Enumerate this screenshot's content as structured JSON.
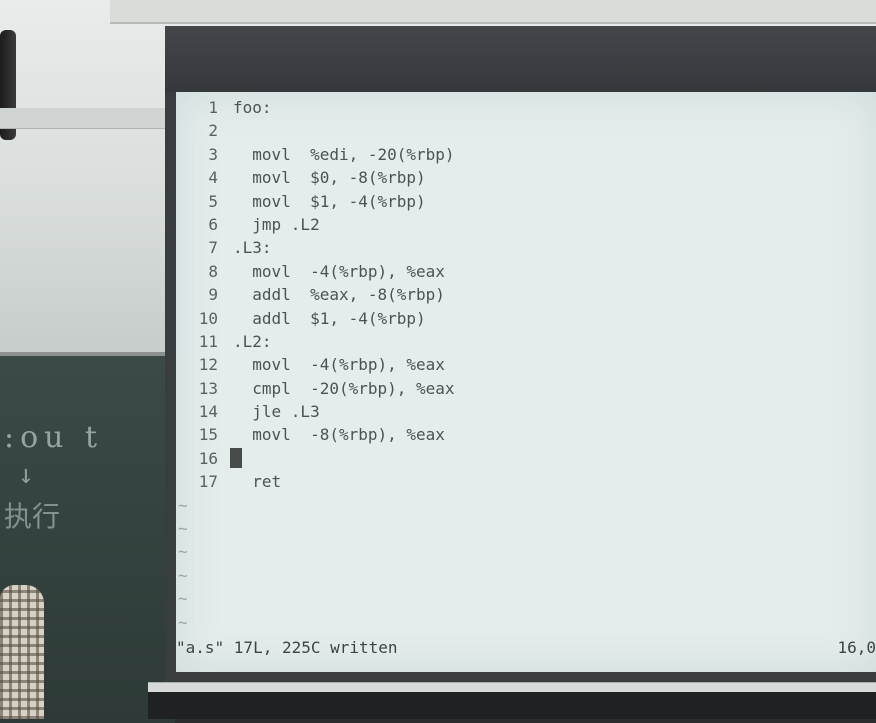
{
  "editor": {
    "lines": [
      {
        "n": "1",
        "text": "foo:"
      },
      {
        "n": "2",
        "text": ""
      },
      {
        "n": "3",
        "text": "  movl  %edi, -20(%rbp)"
      },
      {
        "n": "4",
        "text": "  movl  $0, -8(%rbp)"
      },
      {
        "n": "5",
        "text": "  movl  $1, -4(%rbp)"
      },
      {
        "n": "6",
        "text": "  jmp .L2"
      },
      {
        "n": "7",
        "text": ".L3:"
      },
      {
        "n": "8",
        "text": "  movl  -4(%rbp), %eax"
      },
      {
        "n": "9",
        "text": "  addl  %eax, -8(%rbp)"
      },
      {
        "n": "10",
        "text": "  addl  $1, -4(%rbp)"
      },
      {
        "n": "11",
        "text": ".L2:"
      },
      {
        "n": "12",
        "text": "  movl  -4(%rbp), %eax"
      },
      {
        "n": "13",
        "text": "  cmpl  -20(%rbp), %eax"
      },
      {
        "n": "14",
        "text": "  jle .L3"
      },
      {
        "n": "15",
        "text": "  movl  -8(%rbp), %eax"
      },
      {
        "n": "16",
        "text": ""
      },
      {
        "n": "17",
        "text": "  ret"
      }
    ],
    "tilde": "~",
    "status_message": "\"a.s\" 17L, 225C written",
    "cursor_position": "16,0"
  }
}
